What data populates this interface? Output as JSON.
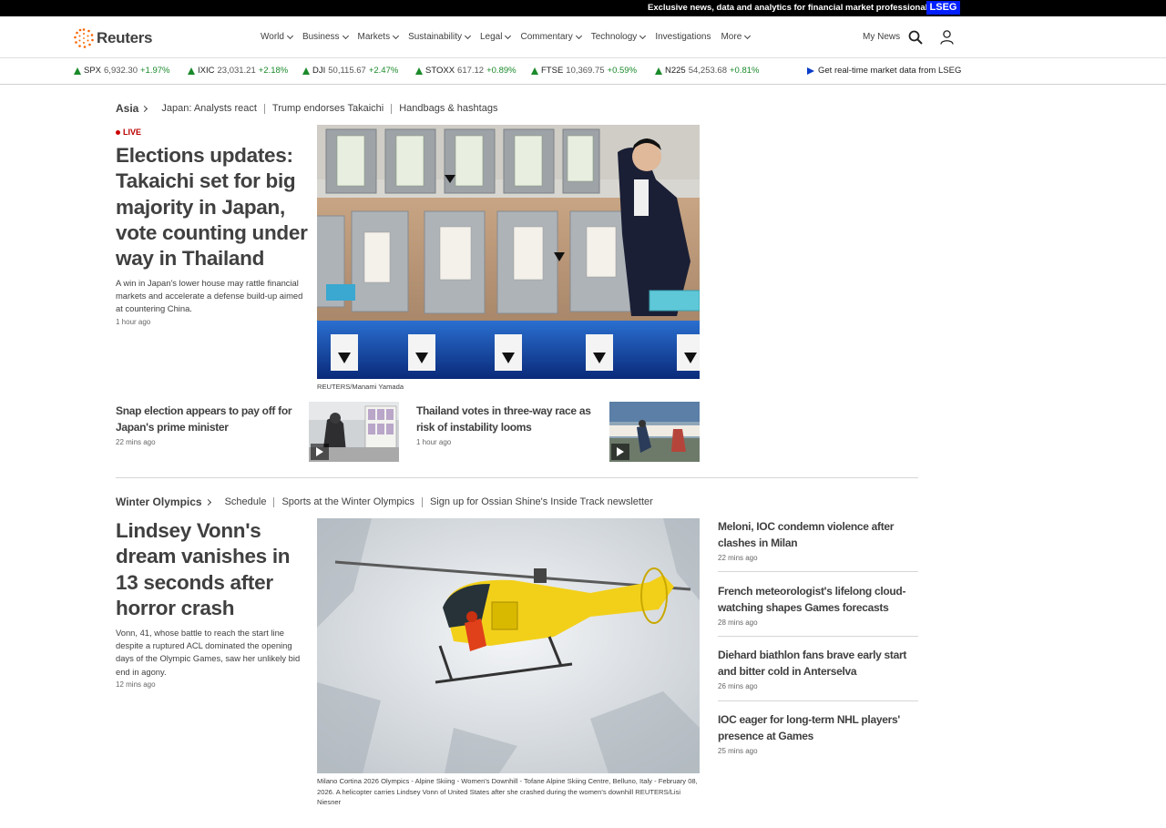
{
  "topbar": {
    "text": "Exclusive news, data and analytics for financial market professionals",
    "badge": "LSEG"
  },
  "header": {
    "logo_text": "Reuters",
    "nav": [
      {
        "label": "World",
        "has_menu": true
      },
      {
        "label": "Business",
        "has_menu": true
      },
      {
        "label": "Markets",
        "has_menu": true
      },
      {
        "label": "Sustainability",
        "has_menu": true
      },
      {
        "label": "Legal",
        "has_menu": true
      },
      {
        "label": "Commentary",
        "has_menu": true
      },
      {
        "label": "Technology",
        "has_menu": true
      },
      {
        "label": "Investigations",
        "has_menu": false
      },
      {
        "label": "More",
        "has_menu": true
      }
    ],
    "my_news": "My News"
  },
  "ticker": {
    "items": [
      {
        "name": "SPX",
        "value": "6,932.30",
        "change": "+1.97%"
      },
      {
        "name": "IXIC",
        "value": "23,031.21",
        "change": "+2.18%"
      },
      {
        "name": "DJI",
        "value": "50,115.67",
        "change": "+2.47%"
      },
      {
        "name": "STOXX",
        "value": "617.12",
        "change": "+0.89%"
      },
      {
        "name": "FTSE",
        "value": "10,369.75",
        "change": "+0.59%"
      },
      {
        "name": "N225",
        "value": "54,253.68",
        "change": "+0.81%"
      }
    ],
    "lseg_link": "Get real-time market data from LSEG",
    "up_color": "#1a8a2a"
  },
  "asia": {
    "section": "Asia",
    "links": [
      "Japan: Analysts react",
      "Trump endorses Takaichi",
      "Handbags & hashtags"
    ],
    "live_label": "LIVE",
    "headline": "Elections updates: Takaichi set for big majority in Japan, vote counting under way in Thailand",
    "dek": "A win in Japan's lower house may rattle financial markets and accelerate a defense build-up aimed at countering China.",
    "time": "1 hour ago",
    "photo_credit": "REUTERS/Manami Yamada",
    "stories": [
      {
        "headline": "Snap election appears to pay off for Japan's prime minister",
        "time": "22 mins ago"
      },
      {
        "headline": "Thailand votes in three-way race as risk of instability looms",
        "time": "1 hour ago"
      }
    ]
  },
  "olympics": {
    "section": "Winter Olympics",
    "links": [
      "Schedule",
      "Sports at the Winter Olympics",
      "Sign up for Ossian Shine's Inside Track newsletter"
    ],
    "headline": "Lindsey Vonn's dream vanishes in 13 seconds after horror crash",
    "dek": "Vonn, 41, whose battle to reach the start line despite a ruptured ACL dominated the opening days of the Olympic Games, saw her unlikely bid end in agony.",
    "time": "12 mins ago",
    "caption": "Milano Cortina 2026 Olympics - Alpine Skiing - Women's Downhill - Tofane Alpine Skiing Centre, Belluno, Italy - February 08, 2026. A helicopter carries Lindsey Vonn of United States after she crashed during the women's downhill REUTERS/Lisi Niesner",
    "side": [
      {
        "headline": "Meloni, IOC condemn violence after clashes in Milan",
        "time": "22 mins ago"
      },
      {
        "headline": "French meteorologist's lifelong cloud-watching shapes Games forecasts",
        "time": "28 mins ago"
      },
      {
        "headline": "Diehard biathlon fans brave early start and bitter cold in Anterselva",
        "time": "26 mins ago"
      },
      {
        "headline": "IOC eager for long-term NHL players' presence at Games",
        "time": "25 mins ago"
      }
    ]
  }
}
